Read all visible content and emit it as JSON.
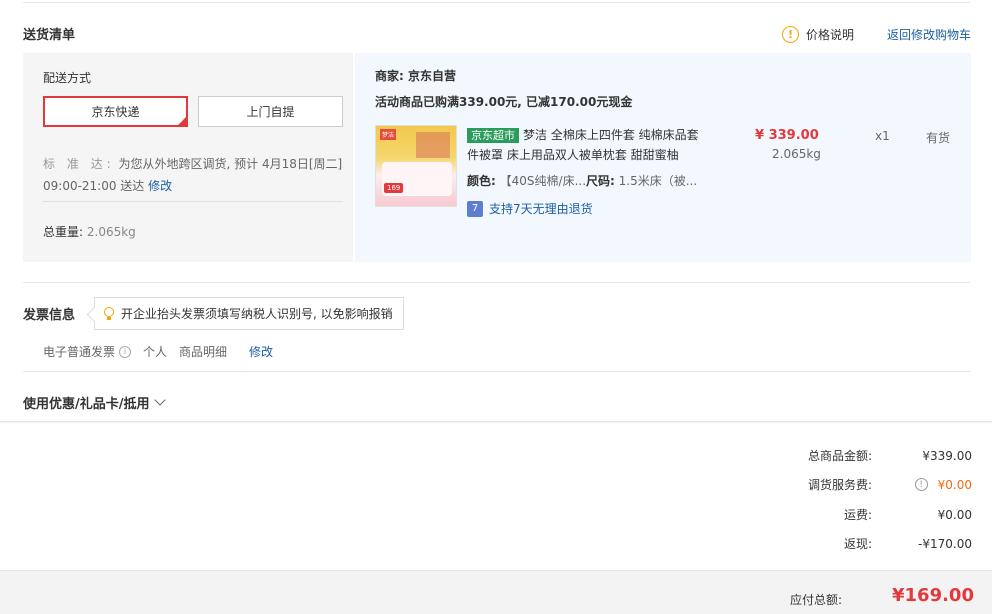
{
  "section_delivery": {
    "title": "送货清单",
    "price_note": "价格说明",
    "back_cart": "返回修改购物车"
  },
  "shipping": {
    "label": "配送方式",
    "options": [
      "京东快递",
      "上门自提"
    ],
    "selected_index": 0,
    "std_label": "标 准 达:",
    "std_text": "为您从外地跨区调货, 预计 4月18日[周二] 09:00-21:00 送达",
    "std_edit": "修改",
    "weight_label": "总重量:",
    "weight_value": "2.065kg"
  },
  "goods": {
    "merchant": "商家: 京东自营",
    "promo": "活动商品已购满339.00元, 已减170.00元现金",
    "tag": "京东超市",
    "name": "梦洁 全棉床上四件套 纯棉床品套件被罩 床上用品双人被单枕套 甜甜蜜柚",
    "color_label": "颜色:",
    "color_value": "【40S纯棉/床...",
    "size_label": "尺码:",
    "size_value": "1.5米床（被...",
    "return_badge": "7",
    "return_text": "支持7天无理由退货",
    "price": "¥ 339.00",
    "weight": "2.065kg",
    "qty": "x1",
    "stock": "有货",
    "thumb_tag": "梦洁",
    "thumb_price": "169"
  },
  "invoice": {
    "title": "发票信息",
    "tip": "开企业抬头发票须填写纳税人识别号, 以免影响报销",
    "type": "电子普通发票",
    "holder": "个人",
    "content": "商品明细",
    "edit": "修改"
  },
  "coupon": {
    "title": "使用优惠/礼品卡/抵用"
  },
  "summary": {
    "rows": [
      {
        "label": "总商品金额:",
        "value": "¥339.00"
      },
      {
        "label": "调货服务费:",
        "value": "¥0.00"
      },
      {
        "label": "运费:",
        "value": "¥0.00"
      },
      {
        "label": "返现:",
        "value": "-¥170.00"
      }
    ],
    "total_label": "应付总额:",
    "total_value": "¥169.00"
  }
}
